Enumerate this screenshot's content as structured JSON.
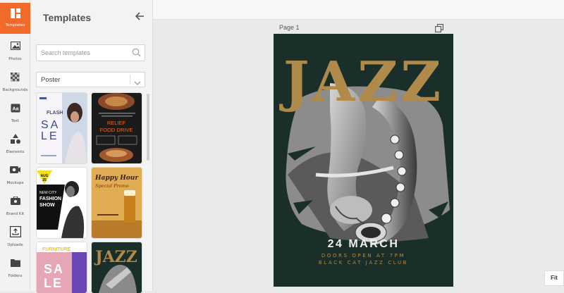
{
  "rail": {
    "items": [
      {
        "label": "Templates",
        "icon": "templates-icon",
        "active": true
      },
      {
        "label": "Photos",
        "icon": "photos-icon"
      },
      {
        "label": "Backgrounds",
        "icon": "backgrounds-icon"
      },
      {
        "label": "Text",
        "icon": "text-icon"
      },
      {
        "label": "Elements",
        "icon": "elements-icon"
      },
      {
        "label": "Mockups",
        "icon": "mockups-icon"
      },
      {
        "label": "Brand Kit",
        "icon": "brand-kit-icon"
      },
      {
        "label": "Uploads",
        "icon": "uploads-icon"
      },
      {
        "label": "Folders",
        "icon": "folders-icon"
      }
    ]
  },
  "panel": {
    "title": "Templates",
    "search_placeholder": "Search templates",
    "category": "Poster",
    "templates": [
      {
        "name": "flash-sale",
        "lines": [
          "FLASH",
          "SA",
          "LE"
        ]
      },
      {
        "name": "relief-food-drive",
        "lines": [
          "RELIEF",
          "FOOD DRIVE"
        ]
      },
      {
        "name": "fashion-show",
        "lines": [
          "AUG",
          "25",
          "NEW CITY",
          "FASHION",
          "SHOW"
        ]
      },
      {
        "name": "happy-hour",
        "lines": [
          "Happy Hour",
          "Special Promo"
        ]
      },
      {
        "name": "furniture-sale",
        "lines": [
          "FURNITURE",
          "SA",
          "LE"
        ]
      },
      {
        "name": "jazz-mini",
        "lines": [
          "JAZZ"
        ]
      }
    ]
  },
  "canvas": {
    "page_label": "Page 1",
    "fit_label": "Fit"
  },
  "poster": {
    "headline": "JAZZ",
    "date": "24 MARCH",
    "doors": "DOORS OPEN AT 7PM",
    "venue": "BLACK CAT JAZZ CLUB",
    "bg_color": "#1a2e2a",
    "accent_color": "#b08a4a"
  },
  "colors": {
    "accent": "#f26a2a"
  }
}
